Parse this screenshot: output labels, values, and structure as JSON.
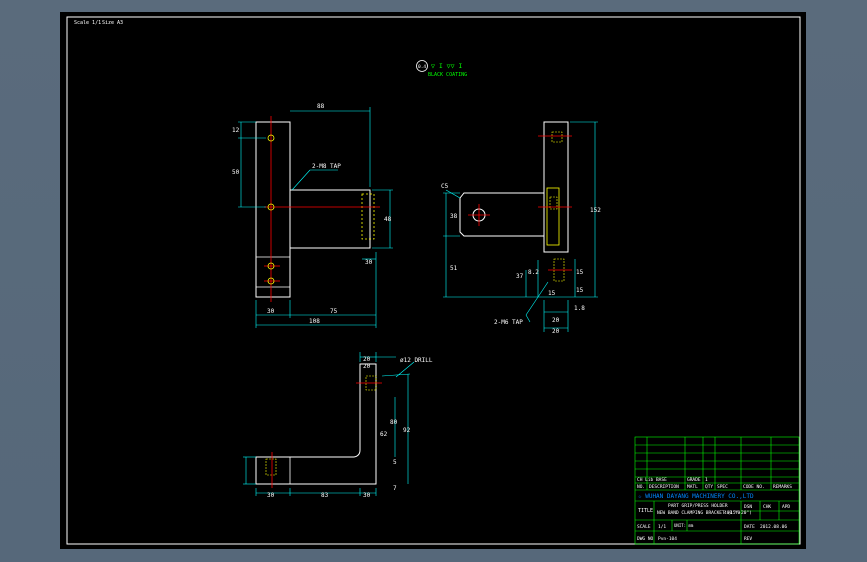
{
  "header": {
    "scale": "Scale 1/1",
    "size": "Size A3"
  },
  "surface_note": {
    "roughness": "0.4",
    "symbol": "▽ I ▽▽ I",
    "coating": "BLACK COATING"
  },
  "view_front": {
    "dims": [
      "88",
      "12",
      "50",
      "48",
      "30",
      "30",
      "75",
      "108"
    ],
    "callout": "2-M8 TAP"
  },
  "view_side": {
    "dims": [
      "C5",
      "38",
      "51",
      "152",
      "37",
      "8.2",
      "15",
      "15",
      "15",
      "1.8",
      "20",
      "20"
    ],
    "callout": "2-M6 TAP"
  },
  "view_top": {
    "dims": [
      "20",
      "20",
      "92",
      "80",
      "62",
      "5",
      "7",
      "30",
      "83",
      "30"
    ],
    "callout": "ø12 DRILL"
  },
  "title_block": {
    "material_note": "CH Lib BASE",
    "grade": "GRADE",
    "qty": "1",
    "headers": [
      "NO.",
      "DESCRIPTION",
      "MATL",
      "QTY",
      "SPEC",
      "CODE NO.",
      "REMARKS"
    ],
    "company": "☆ WUHAN DAYANG MACHINERY CO.,LTD",
    "title_label": "TITLE",
    "title_line1": "PART GRIP/PRESS HOLDER",
    "title_line2": "NEW BAND CLAMPING BRACKET (15\"-20\")",
    "title_code": "400 Y0",
    "dsn": "DSN",
    "chk": "CHK",
    "apd": "APD",
    "scale_label": "SCALE",
    "scale_value": "1/1",
    "unit_label": "UNIT: mm",
    "date_label": "DATE",
    "date_value": "2012.08.06",
    "dwg_label": "DWG NO",
    "dwg_value": "Pvn-104",
    "rev_label": "REV"
  }
}
